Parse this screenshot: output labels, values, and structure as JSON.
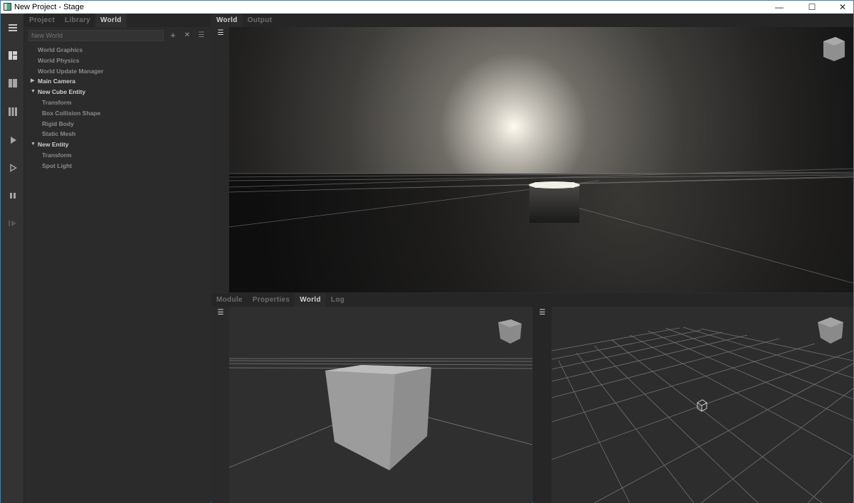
{
  "window": {
    "title": "New Project - Stage",
    "controls": [
      "—",
      "☐",
      "✕"
    ]
  },
  "toolbar": {
    "items": [
      {
        "name": "menu-icon",
        "glyph": "☰"
      },
      {
        "name": "layout-single-icon",
        "glyph": "▦"
      },
      {
        "name": "layout-double-icon",
        "glyph": "▥"
      },
      {
        "name": "layout-triple-icon",
        "glyph": "▥"
      },
      {
        "name": "play-icon",
        "glyph": "▶"
      },
      {
        "name": "play-outline-icon",
        "glyph": "▷"
      },
      {
        "name": "pause-icon",
        "glyph": "❚❚"
      },
      {
        "name": "step-icon",
        "glyph": "❚▶"
      }
    ]
  },
  "left_panel": {
    "tabs": [
      "Project",
      "Library",
      "World"
    ],
    "active_tab": "World",
    "search_placeholder": "New World",
    "buttons": {
      "add": "+",
      "remove": "✕",
      "menu": "☰"
    },
    "tree": [
      {
        "label": "World Graphics",
        "level": 1,
        "parent": false
      },
      {
        "label": "World Physics",
        "level": 1,
        "parent": false
      },
      {
        "label": "World Update Manager",
        "level": 1,
        "parent": false
      },
      {
        "label": "Main Camera",
        "level": 1,
        "parent": true,
        "expanded": false
      },
      {
        "label": "New Cube Entity",
        "level": 1,
        "parent": true,
        "expanded": true
      },
      {
        "label": "Transform",
        "level": 2,
        "parent": false
      },
      {
        "label": "Box Collision Shape",
        "level": 2,
        "parent": false
      },
      {
        "label": "Rigid Body",
        "level": 2,
        "parent": false
      },
      {
        "label": "Static Mesh",
        "level": 2,
        "parent": false
      },
      {
        "label": "New Entity",
        "level": 1,
        "parent": true,
        "expanded": true
      },
      {
        "label": "Transform",
        "level": 2,
        "parent": false
      },
      {
        "label": "Spot Light",
        "level": 2,
        "parent": false
      }
    ]
  },
  "top_view": {
    "tabs": [
      "World",
      "Output"
    ],
    "active_tab": "World",
    "menu_glyph": "☰"
  },
  "bottom_view": {
    "tabs": [
      "Module",
      "Properties",
      "World",
      "Log"
    ],
    "active_tab": "World",
    "menu_glyph": "☰"
  },
  "colors": {
    "panel_bg": "#2b2b2b",
    "tab_active_text": "#cfcfcf",
    "tab_inactive_text": "#6d6d6d",
    "viewport_grid": "#8a8a8a",
    "cube_face": "#9d9d9d"
  }
}
